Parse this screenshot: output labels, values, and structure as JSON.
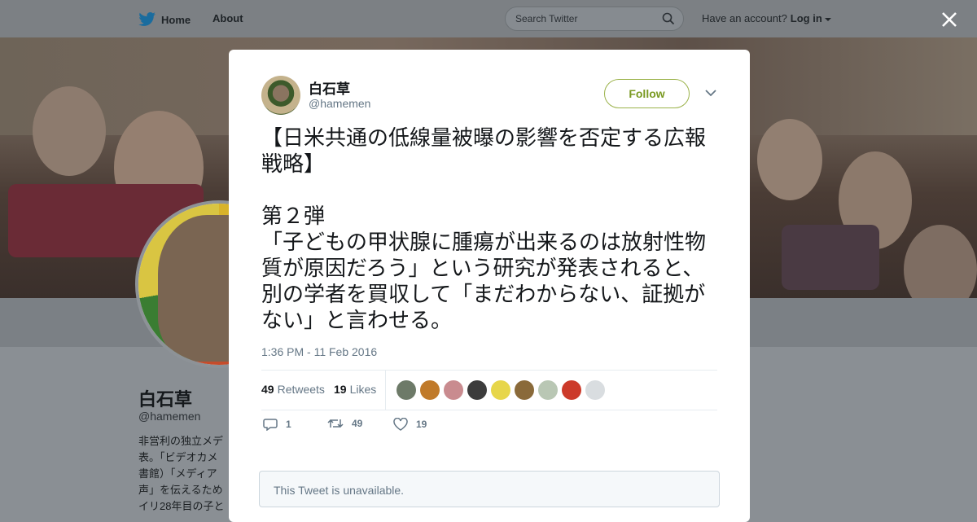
{
  "nav": {
    "home_label": "Home",
    "about_label": "About",
    "search_placeholder": "Search Twitter",
    "account_prompt": "Have an account?",
    "login_label": "Log in"
  },
  "profile": {
    "name": "白石草",
    "handle": "@hamemen",
    "bio": "非営利の独立メデ\n表。「ビデオカメ\n書館）「メディア\n声」を伝えるため\nイリ28年目の子と"
  },
  "tweet": {
    "name": "白石草",
    "handle": "@hamemen",
    "follow_label": "Follow",
    "text": "【日米共通の低線量被曝の影響を否定する広報戦略】\n\n第２弾\n「子どもの甲状腺に腫瘍が出来るのは放射性物質が原因だろう」という研究が発表されると、別の学者を買収して「まだわからない、証拠がない」と言わせる。",
    "timestamp": "1:36 PM - 11 Feb 2016",
    "retweets_count": "49",
    "retweets_label": "Retweets",
    "likes_count": "19",
    "likes_label": "Likes",
    "reply_count": "1",
    "retweet_action_count": "49",
    "like_action_count": "19",
    "quoted_unavailable": "This Tweet is unavailable."
  },
  "colors": {
    "twitter_blue": "#1da1f2",
    "follow_green": "#7a9a22",
    "overlay_gray": "#8a8f94"
  },
  "icons": [
    "twitter-bird-icon",
    "search-icon",
    "close-icon",
    "reply-icon",
    "retweet-icon",
    "like-icon",
    "chevron-down-icon"
  ]
}
